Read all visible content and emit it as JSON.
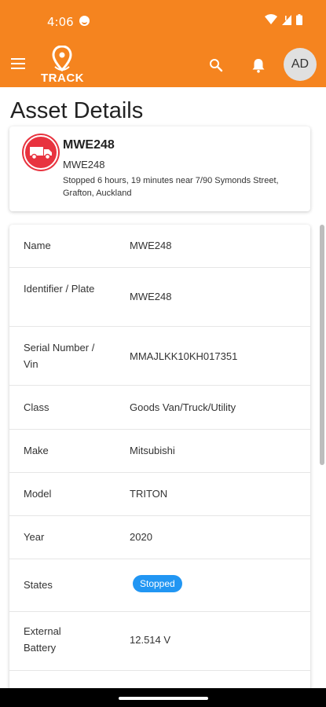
{
  "status_bar": {
    "time": "4:06"
  },
  "app_bar": {
    "logo_text": "TRACK",
    "avatar_initials": "AD",
    "icons": [
      "menu-icon",
      "location-pin-icon",
      "search-icon",
      "bell-icon"
    ]
  },
  "page": {
    "title": "Asset Details"
  },
  "asset": {
    "name": "MWE248",
    "identifier": "MWE248",
    "status_text": "Stopped 6 hours, 19 minutes near 7/90 Symonds Street, Grafton, Auckland",
    "badge_color": "#e8333f"
  },
  "details": {
    "rows": [
      {
        "label": "Name",
        "value": "MWE248"
      },
      {
        "label": "Identifier / Plate",
        "value": "MWE248"
      },
      {
        "label": "Serial Number / Vin",
        "value": "MMAJLKK10KH017351"
      },
      {
        "label": "Class",
        "value": "Goods Van/Truck/Utility"
      },
      {
        "label": "Make",
        "value": "Mitsubishi"
      },
      {
        "label": "Model",
        "value": "TRITON"
      },
      {
        "label": "Year",
        "value": "2020"
      },
      {
        "label": "States",
        "value": "Stopped"
      },
      {
        "label": "External Battery",
        "value": "12.514 V"
      }
    ]
  },
  "colors": {
    "brand": "#f5841f",
    "chip": "#2196f3"
  }
}
